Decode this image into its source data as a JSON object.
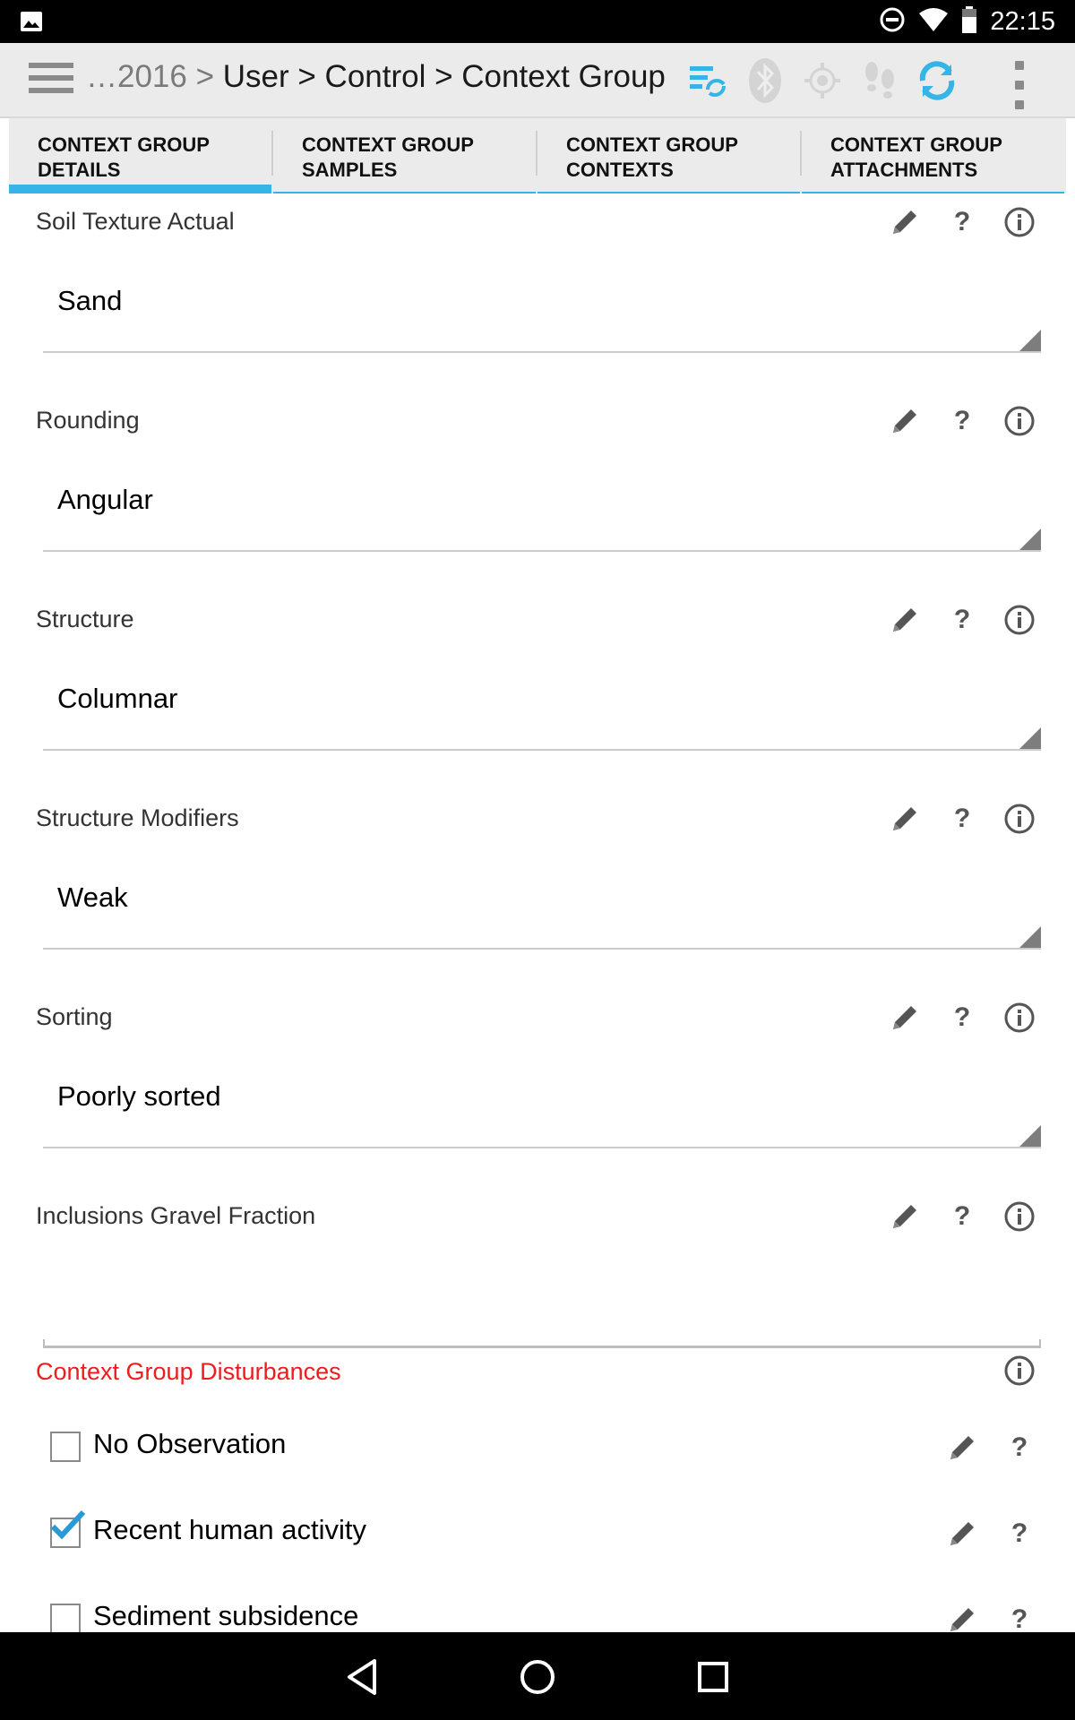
{
  "status_bar": {
    "time": "22:15",
    "icons": [
      "image-icon",
      "do-not-disturb-icon",
      "wifi-icon",
      "battery-icon"
    ]
  },
  "action_bar": {
    "breadcrumb_prefix": "…2016 >",
    "breadcrumb_path": "User > Control > Context Group",
    "icons": [
      "menu-icon",
      "sync-status-icon",
      "bluetooth-icon",
      "gps-icon",
      "tracker-icon",
      "sync-icon",
      "overflow-menu-icon"
    ],
    "accent": "#34b5e5"
  },
  "tabs": [
    {
      "line1": "CONTEXT GROUP",
      "line2": "DETAILS",
      "active": true
    },
    {
      "line1": "CONTEXT GROUP",
      "line2": "SAMPLES",
      "active": false
    },
    {
      "line1": "CONTEXT GROUP",
      "line2": "CONTEXTS",
      "active": false
    },
    {
      "line1": "CONTEXT GROUP",
      "line2": "ATTACHMENTS",
      "active": false
    }
  ],
  "fields": [
    {
      "label": "Soil Texture Actual",
      "value": "Sand"
    },
    {
      "label": "Rounding",
      "value": "Angular"
    },
    {
      "label": "Structure",
      "value": "Columnar"
    },
    {
      "label": "Structure Modifiers",
      "value": "Weak"
    },
    {
      "label": "Sorting",
      "value": "Poorly sorted"
    },
    {
      "label": "Inclusions Gravel Fraction",
      "value": ""
    }
  ],
  "disturbances": {
    "title": "Context Group Disturbances",
    "title_color": "#ee1c1c",
    "items": [
      {
        "label": "No Observation",
        "checked": false
      },
      {
        "label": "Recent human activity",
        "checked": true
      },
      {
        "label": "Sediment subsidence",
        "checked": false
      }
    ]
  },
  "nav_bar": {
    "buttons": [
      "back-icon",
      "home-icon",
      "recents-icon"
    ]
  }
}
